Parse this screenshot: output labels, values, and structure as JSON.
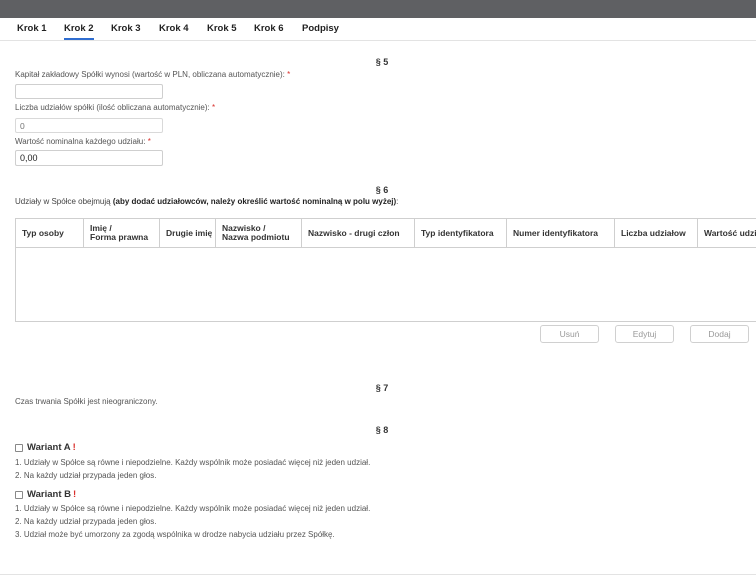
{
  "tabs": [
    {
      "label": "Krok 1",
      "active": false
    },
    {
      "label": "Krok 2",
      "active": true
    },
    {
      "label": "Krok 3",
      "active": false
    },
    {
      "label": "Krok 4",
      "active": false
    },
    {
      "label": "Krok 5",
      "active": false
    },
    {
      "label": "Krok 6",
      "active": false
    },
    {
      "label": "Podpisy",
      "active": false
    }
  ],
  "s5": {
    "title": "§ 5",
    "capital_label": "Kapitał zakładowy Spółki wynosi (wartość w PLN, obliczana automatycznie):",
    "capital_value": "",
    "shares_label": "Liczba udziałów spółki (ilość obliczana automatycznie):",
    "shares_placeholder": "0",
    "nominal_label": "Wartość nominalna każdego udziału:",
    "nominal_value": "0,00",
    "required_mark": "*"
  },
  "s6": {
    "title": "§ 6",
    "intro_normal": "Udziały w Spółce obejmują ",
    "intro_bold": "(aby dodać udziałowców, należy określić wartość nominalną w polu wyżej)",
    "intro_end": ":",
    "columns": [
      [
        "Typ osoby"
      ],
      [
        "Imię /",
        "Forma prawna"
      ],
      [
        "Drugie imię"
      ],
      [
        "Nazwisko /",
        "Nazwa podmiotu"
      ],
      [
        "Nazwisko - drugi człon"
      ],
      [
        "Typ identyfikatora"
      ],
      [
        "Numer identyfikatora"
      ],
      [
        "Liczba udziałow"
      ],
      [
        "Wartość udziałów"
      ]
    ],
    "buttons": {
      "remove": "Usuń",
      "edit": "Edytuj",
      "add": "Dodaj"
    }
  },
  "s7": {
    "title": "§ 7",
    "text": "Czas trwania Spółki jest nieograniczony."
  },
  "s8": {
    "title": "§ 8",
    "variant_a": {
      "label": "Wariant A",
      "mark": "!",
      "lines": [
        "1. Udziały w Spółce są równe i niepodzielne. Każdy wspólnik może posiadać więcej niż jeden udział.",
        "2. Na każdy udział przypada jeden głos."
      ]
    },
    "variant_b": {
      "label": "Wariant B",
      "mark": "!",
      "lines": [
        "1. Udziały w Spółce są równe i niepodzielne. Każdy wspólnik może posiadać więcej niż jeden udział.",
        "2. Na każdy udział przypada jeden głos.",
        "3. Udział może być umorzony za zgodą wspólnika w drodze nabycia udziału przez Spółkę."
      ]
    }
  }
}
